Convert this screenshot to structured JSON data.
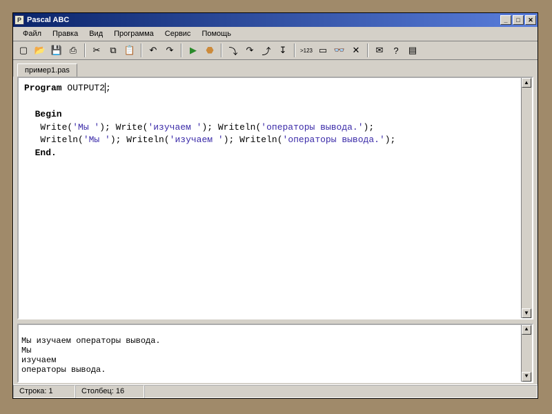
{
  "window": {
    "title": "Pascal ABC",
    "icon_label": "P"
  },
  "window_controls": {
    "minimize": "_",
    "maximize": "□",
    "close": "✕"
  },
  "menubar": {
    "items": [
      "Файл",
      "Правка",
      "Вид",
      "Программа",
      "Сервис",
      "Помощь"
    ]
  },
  "toolbar": {
    "groups": [
      [
        "new-file-icon",
        "open-file-icon",
        "save-icon",
        "save-all-icon"
      ],
      [
        "cut-icon",
        "copy-icon",
        "paste-icon"
      ],
      [
        "undo-icon",
        "redo-icon"
      ],
      [
        "run-icon",
        "stop-icon"
      ],
      [
        "step-into-icon",
        "step-over-icon",
        "step-out-icon",
        "run-to-cursor-icon"
      ],
      [
        "goto-line-icon",
        "window-icon",
        "watch-icon",
        "clear-icon"
      ],
      [
        "msg-icon",
        "help-icon",
        "panel-icon"
      ]
    ],
    "glyphs": {
      "new-file-icon": "▢",
      "open-file-icon": "📂",
      "save-icon": "💾",
      "save-all-icon": "⎙",
      "cut-icon": "✂",
      "copy-icon": "⧉",
      "paste-icon": "📋",
      "undo-icon": "↶",
      "redo-icon": "↷",
      "run-icon": "▶",
      "stop-icon": "⬣",
      "step-into-icon": "⤵",
      "step-over-icon": "↷",
      "step-out-icon": "⤴",
      "run-to-cursor-icon": "↧",
      "goto-line-icon": ">123",
      "window-icon": "▭",
      "watch-icon": "👓",
      "clear-icon": "✕",
      "msg-icon": "✉",
      "help-icon": "?",
      "panel-icon": "▤"
    }
  },
  "tabs": {
    "active": "пример1.pas"
  },
  "code": {
    "l1a": "Program ",
    "l1b": "OUTPUT2",
    "l1c": ";",
    "l2": "",
    "l3": "  Begin",
    "l4a": "   Write(",
    "l4s1": "'Mы '",
    "l4b": "); Write(",
    "l4s2": "'изучaeм '",
    "l4c": "); Writeln(",
    "l4s3": "'oпepaтopы вывoдa.'",
    "l4d": ");",
    "l5a": "   Writeln(",
    "l5s1": "'Mы '",
    "l5b": "); Writeln(",
    "l5s2": "'изучaeм '",
    "l5c": "); Writeln(",
    "l5s3": "'oпepaтopы вывoдa.'",
    "l5d": ");",
    "l6": "  End."
  },
  "output": {
    "line1": "Mы изучaeм oпepaтopы вывoдa.",
    "line2": "Mы",
    "line3": "изучaeм",
    "line4": "oпepaтopы вывoдa."
  },
  "status": {
    "line_label": "Строка: 1",
    "col_label": "Столбец: 16"
  }
}
